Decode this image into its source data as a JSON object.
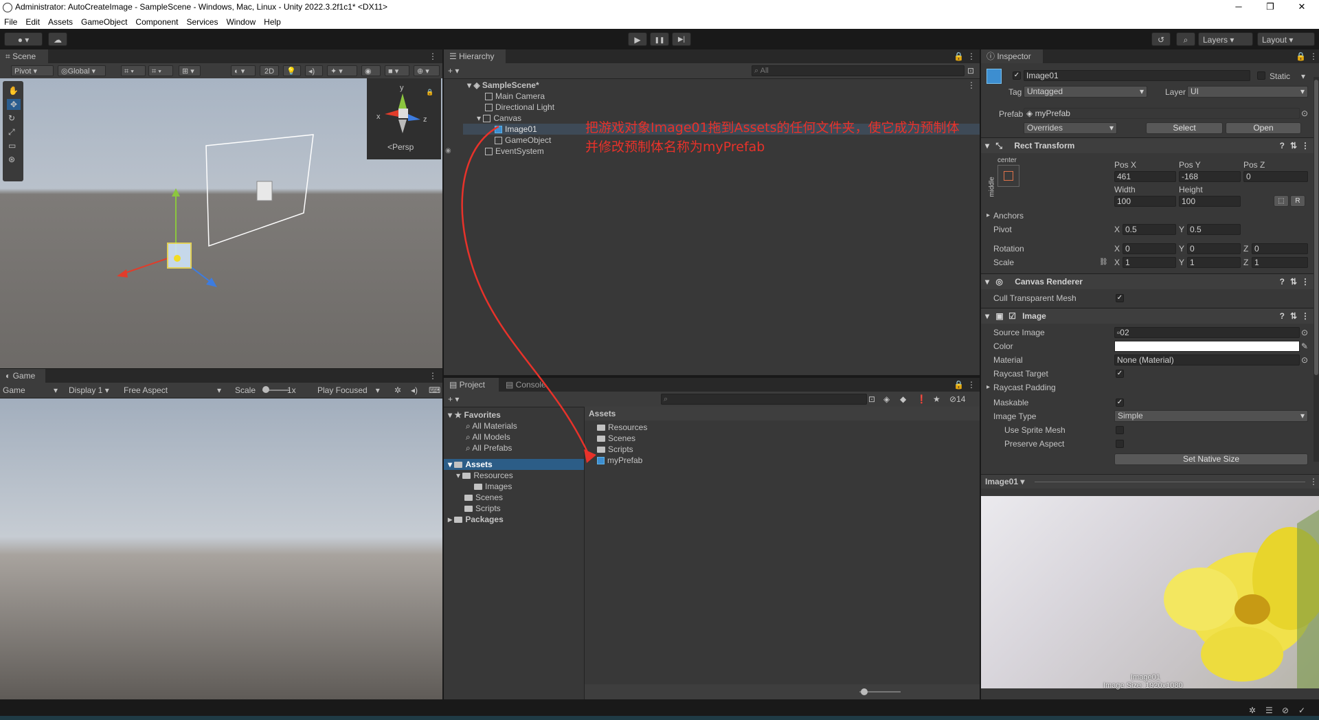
{
  "window": {
    "title": "Administrator: AutoCreateImage - SampleScene - Windows, Mac, Linux - Unity 2022.3.2f1c1* <DX11>",
    "controls": [
      "─",
      "❐",
      "✕"
    ]
  },
  "menu": [
    "File",
    "Edit",
    "Assets",
    "GameObject",
    "Component",
    "Services",
    "Window",
    "Help"
  ],
  "toolbar": {
    "play": "▶",
    "pause": "❚❚",
    "step": "▶|",
    "layers_label": "Layers",
    "layout_label": "Layout"
  },
  "scene": {
    "tab": "Scene",
    "pivot": "Pivot",
    "global": "Global",
    "mode_2d": "2D",
    "persp": "<Persp",
    "gizmo_axes": [
      "y",
      "x",
      "z"
    ]
  },
  "game": {
    "tab": "Game",
    "mode": "Game",
    "display": "Display 1",
    "aspect": "Free Aspect",
    "scale_label": "Scale",
    "scale_value": "1x",
    "play_focused": "Play Focused"
  },
  "hierarchy": {
    "tab": "Hierarchy",
    "search_placeholder": "All",
    "items": [
      {
        "label": "SampleScene*",
        "depth": 0
      },
      {
        "label": "Main Camera",
        "depth": 1
      },
      {
        "label": "Directional Light",
        "depth": 1
      },
      {
        "label": "Canvas",
        "depth": 1
      },
      {
        "label": "Image01",
        "depth": 2
      },
      {
        "label": "GameObject",
        "depth": 2
      },
      {
        "label": "EventSystem",
        "depth": 1
      }
    ]
  },
  "annotation": {
    "line1": "把游戏对象Image01拖到Assets的任何文件夹，使它成为预制体",
    "line2": "并修改预制体名称为myPrefab",
    "color": "#e8322a"
  },
  "project": {
    "tabs": [
      "Project",
      "Console"
    ],
    "hidden_count": "14",
    "favorites_label": "Favorites",
    "favorites": [
      "All Materials",
      "All Models",
      "All Prefabs"
    ],
    "tree": [
      {
        "label": "Assets",
        "depth": 0,
        "selected": true
      },
      {
        "label": "Resources",
        "depth": 1
      },
      {
        "label": "Images",
        "depth": 2
      },
      {
        "label": "Scenes",
        "depth": 1
      },
      {
        "label": "Scripts",
        "depth": 1
      },
      {
        "label": "Packages",
        "depth": 0
      }
    ],
    "breadcrumb": "Assets",
    "contents": [
      "Resources",
      "Scenes",
      "Scripts",
      "myPrefab"
    ]
  },
  "inspector": {
    "tab": "Inspector",
    "object_name": "Image01",
    "static_label": "Static",
    "tag_label": "Tag",
    "tag_value": "Untagged",
    "layer_label": "Layer",
    "layer_value": "UI",
    "prefab_label": "Prefab",
    "prefab_value": "myPrefab",
    "overrides": "Overrides",
    "select_btn": "Select",
    "open_btn": "Open",
    "rect_transform": {
      "title": "Rect Transform",
      "anchor_h": "center",
      "anchor_v": "middle",
      "posx_label": "Pos X",
      "posy_label": "Pos Y",
      "posz_label": "Pos Z",
      "posx": "461",
      "posy": "-168",
      "posz": "0",
      "width_label": "Width",
      "height_label": "Height",
      "width": "100",
      "height": "100",
      "r_btn": "R",
      "anchors_label": "Anchors",
      "pivot_label": "Pivot",
      "pivot_x": "0.5",
      "pivot_y": "0.5",
      "rotation_label": "Rotation",
      "rot_x": "0",
      "rot_y": "0",
      "rot_z": "0",
      "scale_label": "Scale",
      "scale_x": "1",
      "scale_y": "1",
      "scale_z": "1",
      "x": "X",
      "y": "Y",
      "z": "Z"
    },
    "canvas_renderer": {
      "title": "Canvas Renderer",
      "cull_label": "Cull Transparent Mesh"
    },
    "image": {
      "title": "Image",
      "source_label": "Source Image",
      "source_value": "02",
      "color_label": "Color",
      "material_label": "Material",
      "material_value": "None (Material)",
      "raycast_target": "Raycast Target",
      "raycast_padding": "Raycast Padding",
      "maskable": "Maskable",
      "image_type_label": "Image Type",
      "image_type_value": "Simple",
      "use_sprite_mesh": "Use Sprite Mesh",
      "preserve_aspect": "Preserve Aspect",
      "native_size_btn": "Set Native Size"
    },
    "preview": {
      "header": "Image01",
      "caption_name": "Image01",
      "caption_size": "Image Size: 1920x1080"
    }
  }
}
